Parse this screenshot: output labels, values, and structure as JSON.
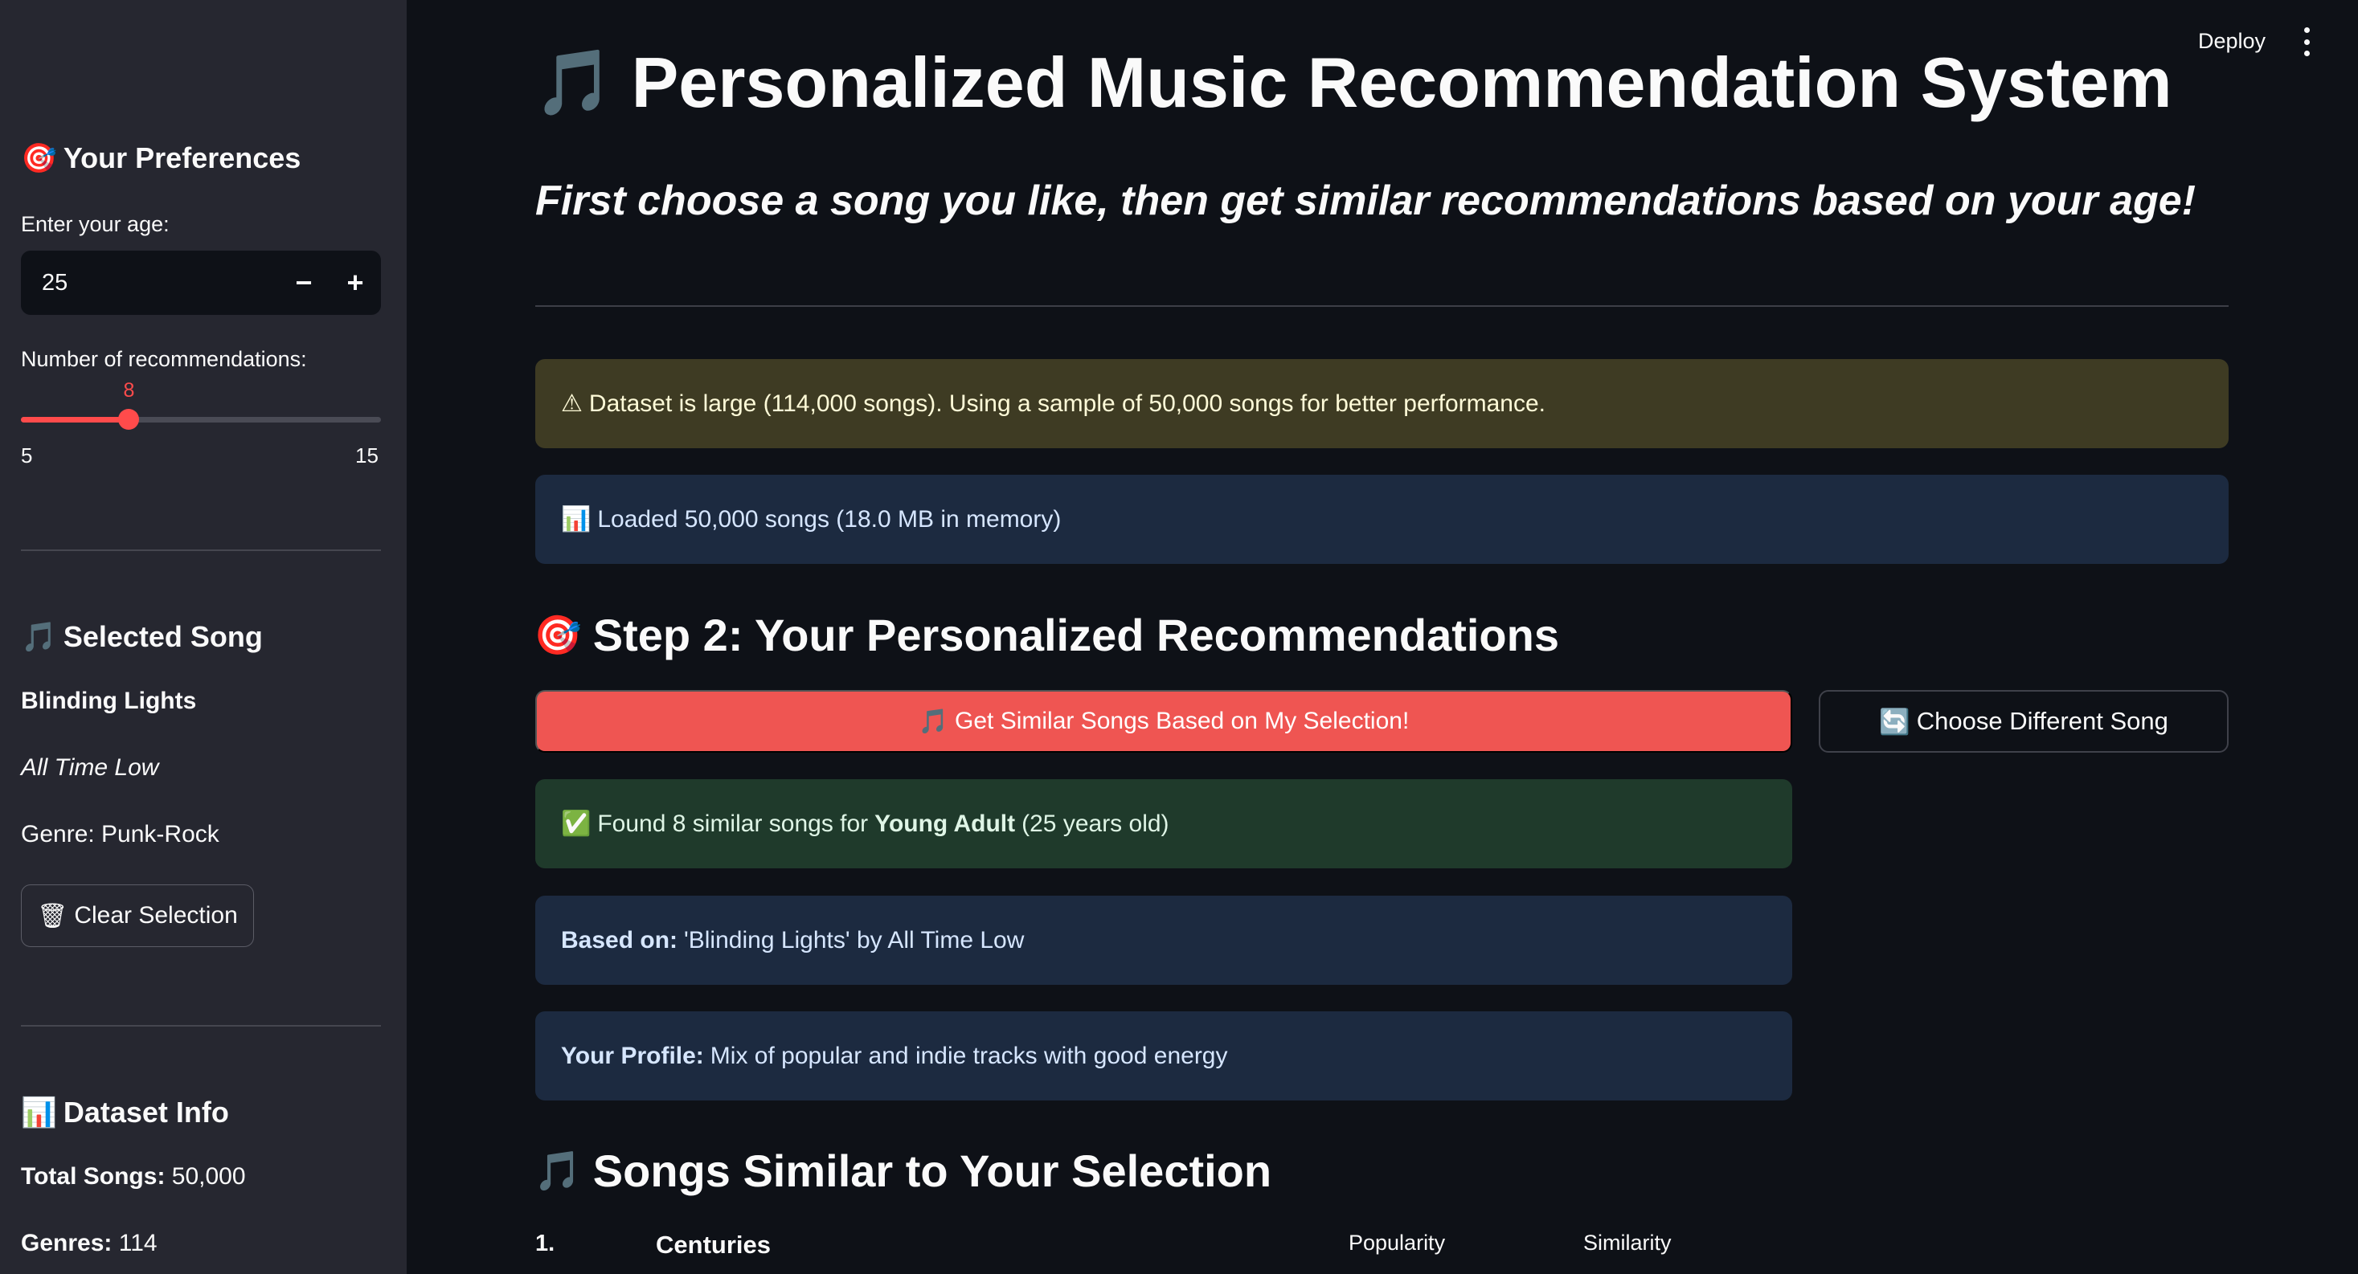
{
  "topbar": {
    "deploy_label": "Deploy",
    "menu_icon": "more-vert-icon"
  },
  "sidebar": {
    "preferences_title": "Your Preferences",
    "preferences_icon": "🎯",
    "age_label": "Enter your age:",
    "age_value": "25",
    "age_decrement": "−",
    "age_increment": "+",
    "recs_label": "Number of recommendations:",
    "recs_value": "8",
    "recs_fraction": 0.3,
    "recs_min": "5",
    "recs_max": "15",
    "selected_title": "Selected Song",
    "selected_icon": "🎵",
    "selected_song": "Blinding Lights",
    "selected_artist": "All Time Low",
    "selected_genre": "Genre: Punk-Rock",
    "clear_label": "Clear Selection",
    "clear_icon": "🗑",
    "dataset_title": "Dataset Info",
    "dataset_icon": "📊",
    "total_songs_label": "Total Songs:",
    "total_songs_value": "50,000",
    "genres_label": "Genres:",
    "genres_value": "114"
  },
  "main": {
    "title": "Personalized Music Recommendation System",
    "title_icon": "🎵",
    "subtitle": "First choose a song you like, then get similar recommendations based on your age!",
    "warning": {
      "icon": "⚠",
      "text": "Dataset is large (114,000 songs). Using a sample of 50,000 songs for better performance."
    },
    "loaded": {
      "icon": "📊",
      "text": "Loaded 50,000 songs (18.0 MB in memory)"
    },
    "step2_title": "Step 2: Your Personalized Recommendations",
    "step2_icon": "🎯",
    "get_similar_label": "Get Similar Songs Based on My Selection!",
    "get_similar_icon": "🎵",
    "choose_diff_label": "Choose Different Song",
    "choose_diff_icon": "🔄",
    "found": {
      "icon": "✅",
      "prefix": "Found 8 similar songs for",
      "bold": "Young Adult",
      "suffix": "(25 years old)"
    },
    "based_on": {
      "label": "Based on:",
      "text": "'Blinding Lights' by All Time Low"
    },
    "profile": {
      "label": "Your Profile:",
      "text": "Mix of popular and indie tracks with good energy"
    },
    "similar_title": "Songs Similar to Your Selection",
    "similar_icon": "🎵",
    "results": [
      {
        "num": "1.",
        "name": "Centuries",
        "popularity_label": "Popularity",
        "similarity_label": "Similarity"
      }
    ]
  },
  "colors": {
    "accent": "#ff4b4b",
    "background": "#0e1117",
    "sidebar": "#262730"
  }
}
